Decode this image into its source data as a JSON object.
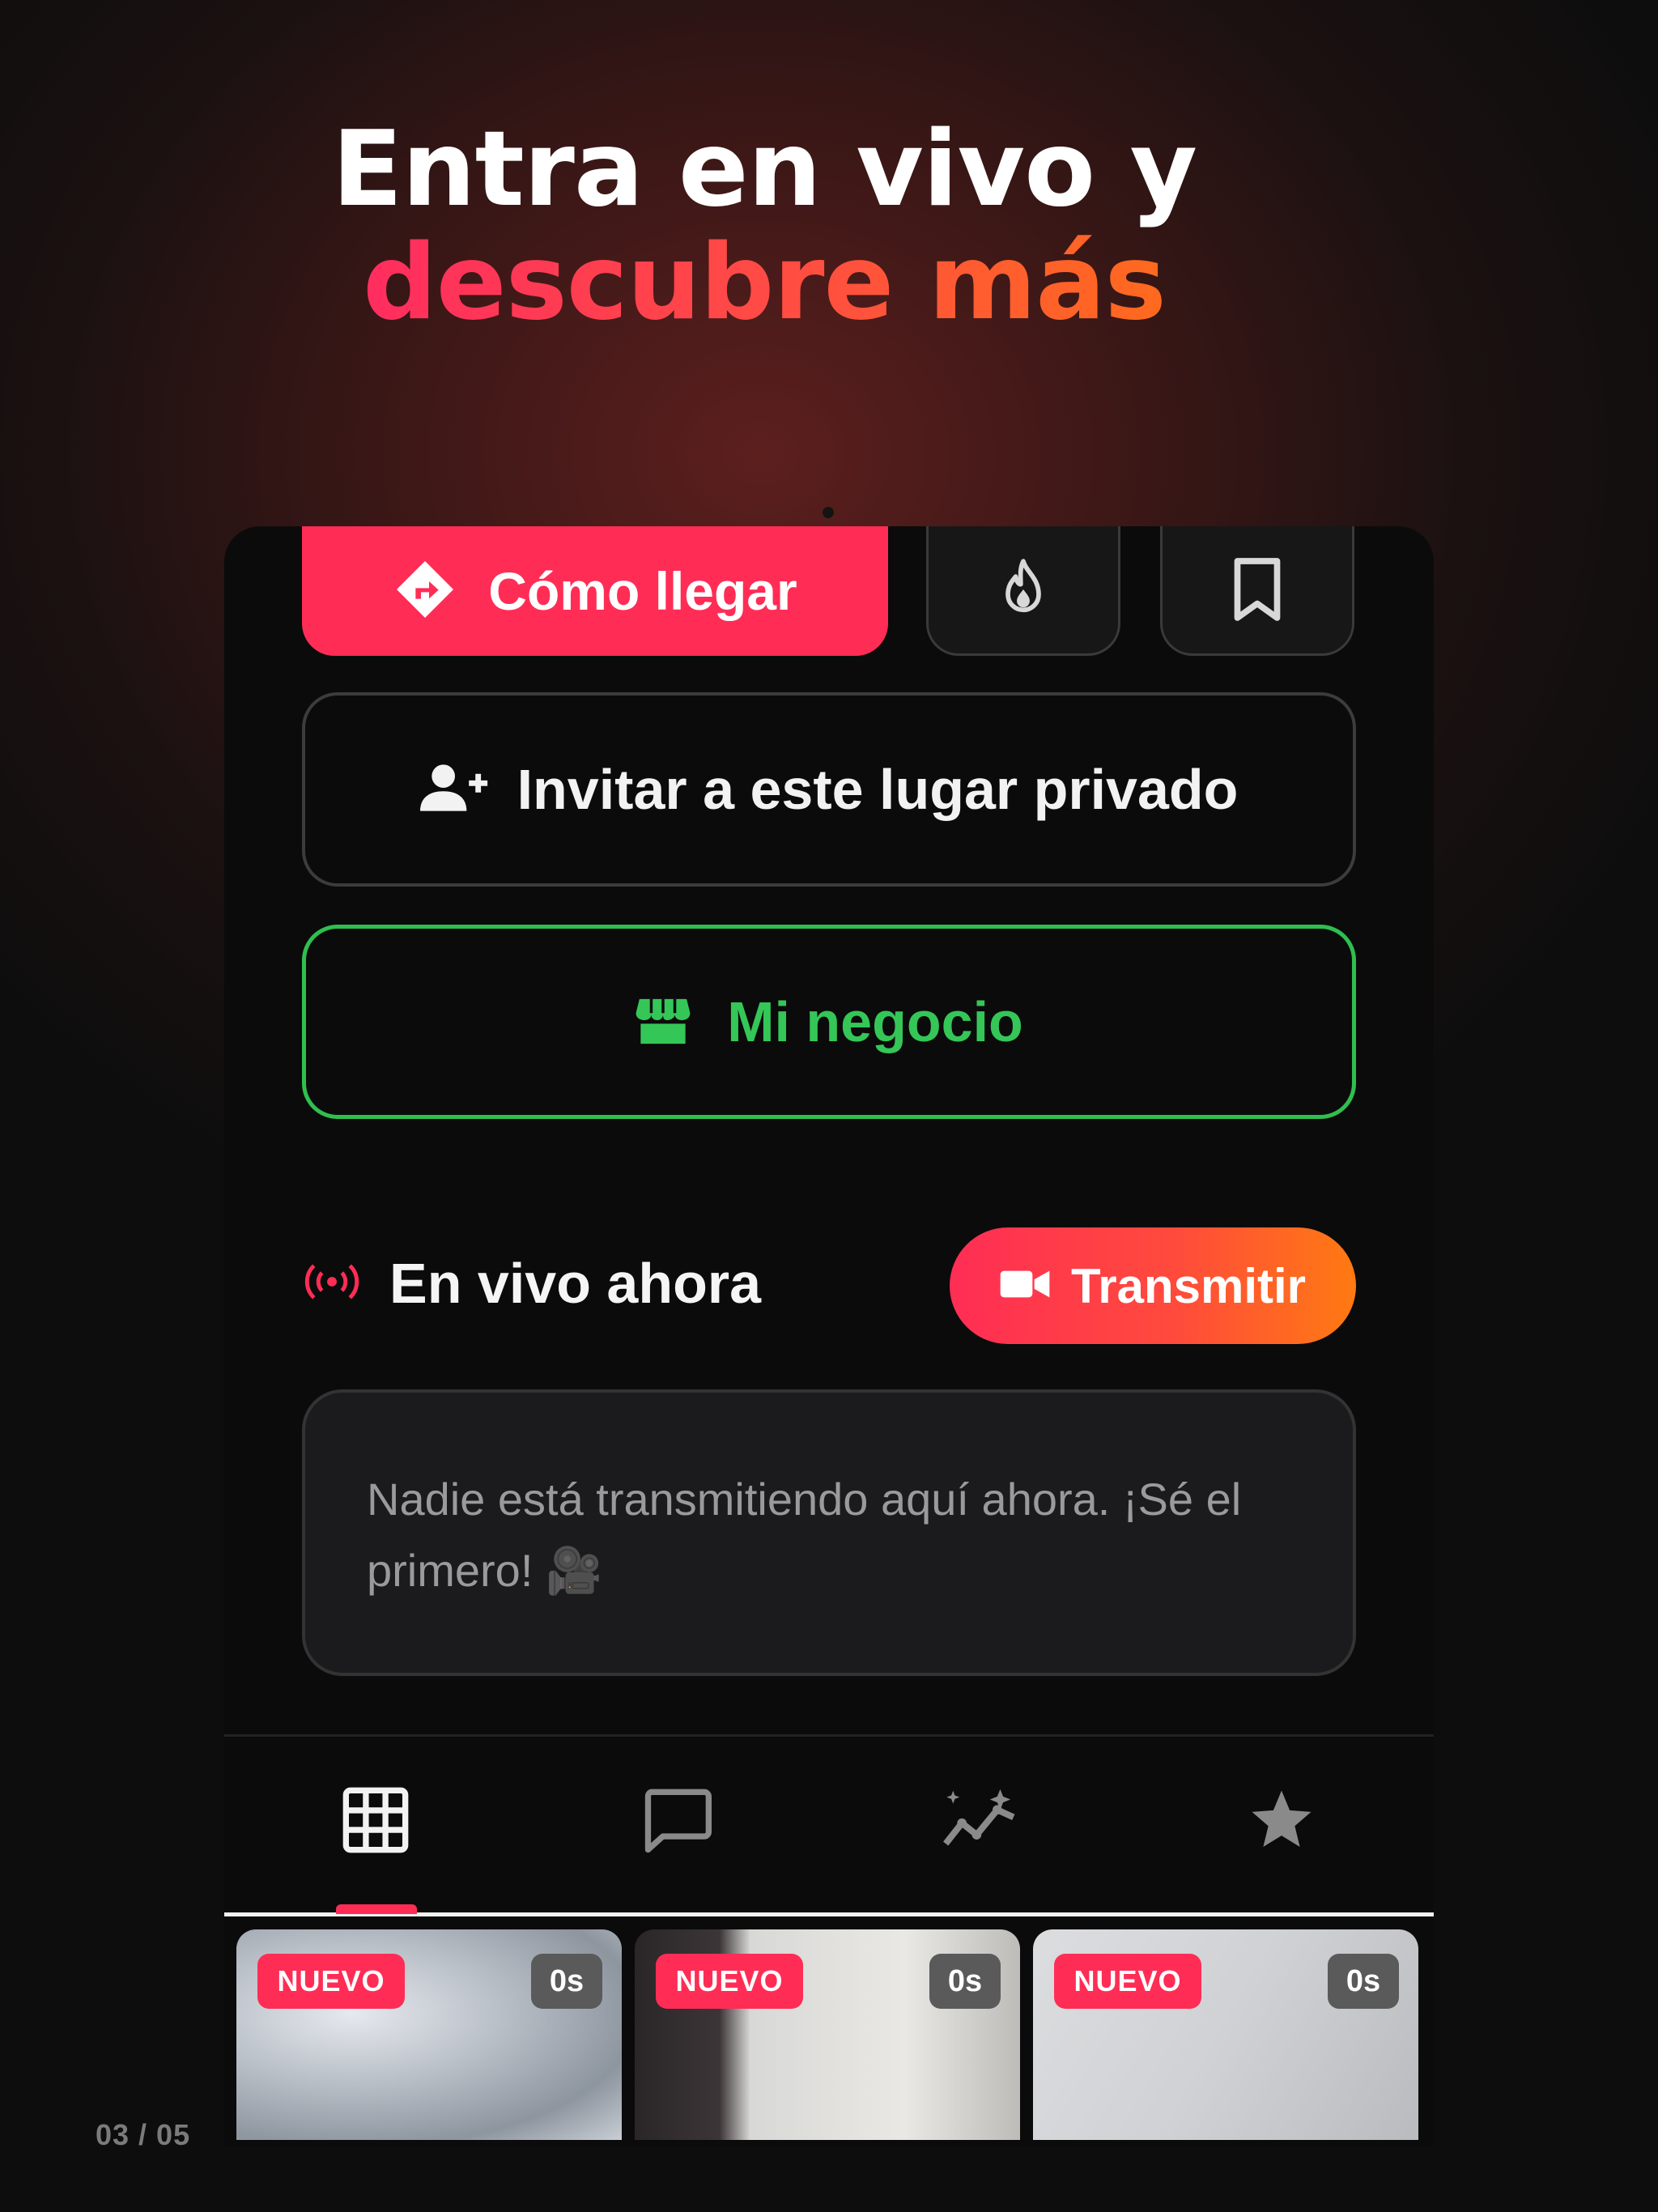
{
  "promo": {
    "headline_line1": "Entra en vivo y",
    "headline_line2": "descubre más",
    "page_indicator": "03 / 05"
  },
  "actions": {
    "directions_label": "Cómo llegar",
    "fire_icon": "fire-icon",
    "bookmark_icon": "bookmark-icon",
    "invite_label": "Invitar a este lugar privado",
    "business_label": "Mi negocio"
  },
  "live": {
    "section_title": "En vivo ahora",
    "stream_button_label": "Transmitir",
    "empty_message": "Nadie está transmitiendo aquí ahora. ¡Sé el primero! 🎥"
  },
  "tabs": [
    {
      "icon": "grid-icon",
      "active": true
    },
    {
      "icon": "chat-icon",
      "active": false
    },
    {
      "icon": "trending-icon",
      "active": false
    },
    {
      "icon": "star-icon",
      "active": false
    }
  ],
  "thumbnails": [
    {
      "badge": "NUEVO",
      "duration": "0s"
    },
    {
      "badge": "NUEVO",
      "duration": "0s"
    },
    {
      "badge": "NUEVO",
      "duration": "0s"
    }
  ],
  "colors": {
    "accent_pink": "#ff2d55",
    "accent_orange": "#ff7a12",
    "business_green": "#35c658",
    "background": "#0b0b0b"
  }
}
